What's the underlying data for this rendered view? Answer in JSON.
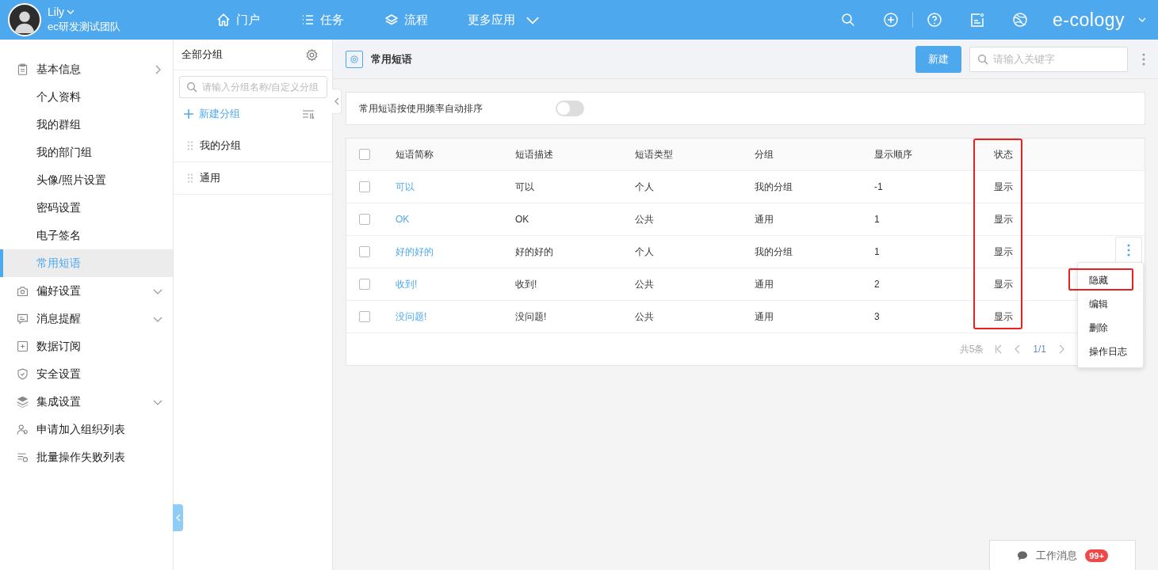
{
  "header": {
    "user": {
      "name": "Lily",
      "team": "ec研发测试团队"
    },
    "nav": [
      {
        "label": "门户",
        "kind": "home"
      },
      {
        "label": "任务",
        "kind": "list"
      },
      {
        "label": "流程",
        "kind": "layers"
      },
      {
        "label": "更多应用",
        "kind": "more"
      }
    ],
    "brand": "e-cology"
  },
  "sidebar": {
    "items": [
      {
        "label": "基本信息",
        "expanded": true,
        "selected": false,
        "children": [
          {
            "label": "个人资料",
            "selected": false
          },
          {
            "label": "我的群组",
            "selected": false
          },
          {
            "label": "我的部门组",
            "selected": false
          },
          {
            "label": "头像/照片设置",
            "selected": false
          },
          {
            "label": "密码设置",
            "selected": false
          },
          {
            "label": "电子签名",
            "selected": false
          },
          {
            "label": "常用短语",
            "selected": true
          }
        ]
      },
      {
        "label": "偏好设置",
        "expanded": false,
        "selected": false
      },
      {
        "label": "消息提醒",
        "expanded": false,
        "selected": false
      },
      {
        "label": "数据订阅",
        "selected": false
      },
      {
        "label": "安全设置",
        "selected": false
      },
      {
        "label": "集成设置",
        "expanded": false,
        "selected": false
      },
      {
        "label": "申请加入组织列表",
        "selected": false
      },
      {
        "label": "批量操作失败列表",
        "selected": false
      }
    ]
  },
  "groups": {
    "title": "全部分组",
    "search_placeholder": "请输入分组名称/自定义分组",
    "new_button": "新建分组",
    "items": [
      {
        "label": "我的分组"
      },
      {
        "label": "通用"
      }
    ]
  },
  "main": {
    "title": "常用短语",
    "new_button": "新建",
    "search_placeholder": "请输入关键字",
    "auto_sort": {
      "label": "常用短语按使用频率自动排序",
      "on": false
    },
    "table": {
      "all_checked": false,
      "columns": [
        {
          "label": "短语简称",
          "highlighted": false
        },
        {
          "label": "短语描述",
          "highlighted": false
        },
        {
          "label": "短语类型",
          "highlighted": false
        },
        {
          "label": "分组",
          "highlighted": false
        },
        {
          "label": "显示顺序",
          "highlighted": false
        },
        {
          "label": "状态",
          "highlighted": true
        }
      ],
      "rows": [
        {
          "checked": false,
          "cells": [
            "可以",
            "可以",
            "个人",
            "我的分组",
            "-1",
            "显示"
          ]
        },
        {
          "checked": false,
          "cells": [
            "OK",
            "OK",
            "公共",
            "通用",
            "1",
            "显示"
          ]
        },
        {
          "checked": false,
          "cells": [
            "好的好的",
            "好的好的",
            "个人",
            "我的分组",
            "1",
            "显示"
          ]
        },
        {
          "checked": false,
          "cells": [
            "收到!",
            "收到!",
            "公共",
            "通用",
            "2",
            "显示"
          ]
        },
        {
          "checked": false,
          "cells": [
            "没问题!",
            "没问题!",
            "公共",
            "通用",
            "3",
            "显示"
          ]
        }
      ]
    },
    "pagination": {
      "total": "共5条",
      "page": "1/1"
    },
    "row_menu": [
      {
        "label": "隐藏",
        "highlighted": true
      },
      {
        "label": "编辑",
        "highlighted": false
      },
      {
        "label": "删除",
        "highlighted": false
      },
      {
        "label": "操作日志",
        "highlighted": false
      }
    ]
  },
  "messages": {
    "label": "工作消息",
    "badge": "99+"
  }
}
